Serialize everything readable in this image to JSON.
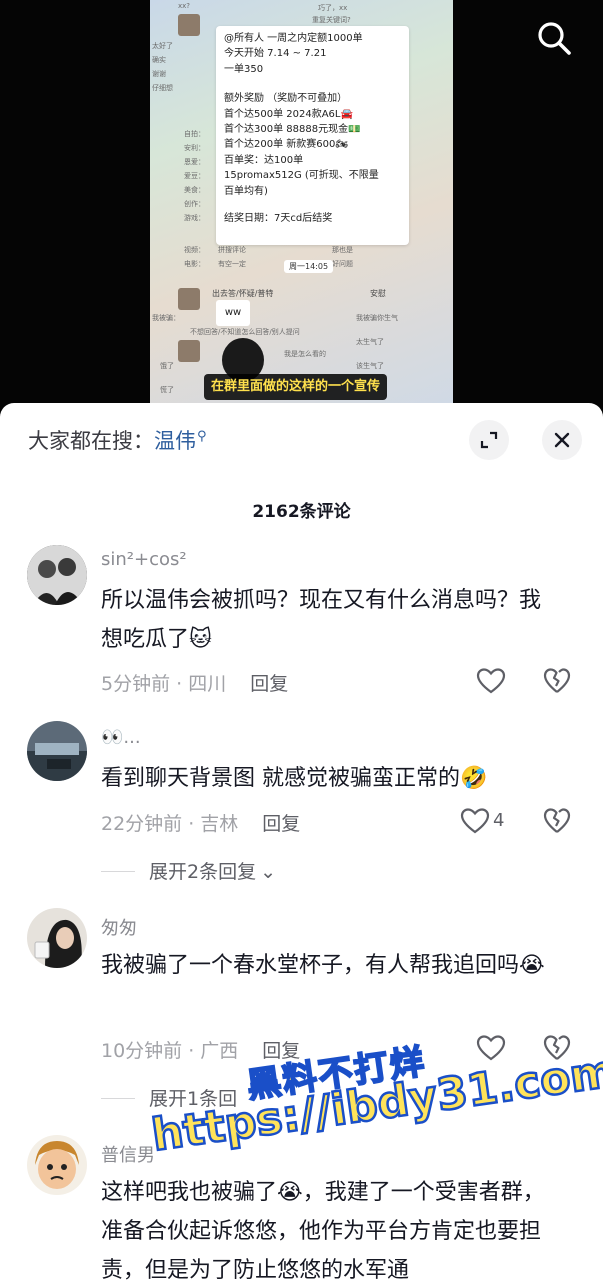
{
  "video": {
    "caption": "在群里面做的这样的一个宣传",
    "notice_lines": [
      "@所有人 一周之内定额1000单",
      "今天开始 7.14 ~ 7.21",
      "一单350",
      "额外奖励 （奖励不可叠加）",
      "首个达500单  2024款A6L🚘",
      "首个达300单 88888元现金💵",
      "首个达200单 新款赛600🏍",
      "百单奖：达100单",
      "15promax512G (可折现、不限量",
      "百单均有)",
      "结奖日期：7天cd后结奖"
    ],
    "time_chip": "周一14:05",
    "bubble_ww": "ww",
    "side_frags": [
      "xx?",
      "巧了，xx",
      "重复关键词?",
      "太好了",
      "确实",
      "谢谢",
      "仔细想",
      "自拍：",
      "安利：",
      "恩爱：",
      "爱豆：",
      "美食：",
      "创作：",
      "游戏：",
      "视频：",
      "电影：",
      "拼搜评论",
      "有空一定",
      "那也是",
      "好问题",
      "出去答/怀疑/普特",
      "安慰",
      "我被骗：",
      "我被骗你生气",
      "不想回答/不知道怎么回答/别人提问",
      "太生气了",
      "我是怎么看的",
      "该生气了",
      "饿了",
      "慌了"
    ]
  },
  "sheet": {
    "search_prefix": "大家都在搜：",
    "search_keyword": "温伟",
    "comment_count": "2162条评论"
  },
  "comments": [
    {
      "name": "sin²+cos²",
      "text": "所以温伟会被抓吗？现在又有什么消息吗？我想吃瓜了",
      "emoji": "🐱",
      "time": "5分钟前 · 四川",
      "reply": "回复",
      "likes": ""
    },
    {
      "name": "👀...",
      "text": "看到聊天背景图 就感觉被骗蛮正常的",
      "emoji": "🤣",
      "time": "22分钟前 · 吉林",
      "reply": "回复",
      "likes": "4",
      "more": "展开2条回复"
    },
    {
      "name": "匆匆",
      "text": "我被骗了一个春水堂杯子，有人帮我追回吗",
      "emoji": "😭",
      "time": "10分钟前 · 广西",
      "reply": "回复",
      "likes": "",
      "more": "展开1条回"
    },
    {
      "name": "普信男",
      "text": "这样吧我也被骗了😭，我建了一个受害者群，准备合伙起诉悠悠，他作为平台方肯定也要担责，但是为了防止悠悠的水军通"
    }
  ],
  "watermark": {
    "line1": "黑料不打烊",
    "line2": "https://ibdy31.com"
  },
  "colors": {
    "keyword": "#2e5e9e",
    "caption_text": "#ffe14d",
    "watermark_fill": "#ffe35a",
    "watermark_stroke": "#1a4fc8"
  }
}
